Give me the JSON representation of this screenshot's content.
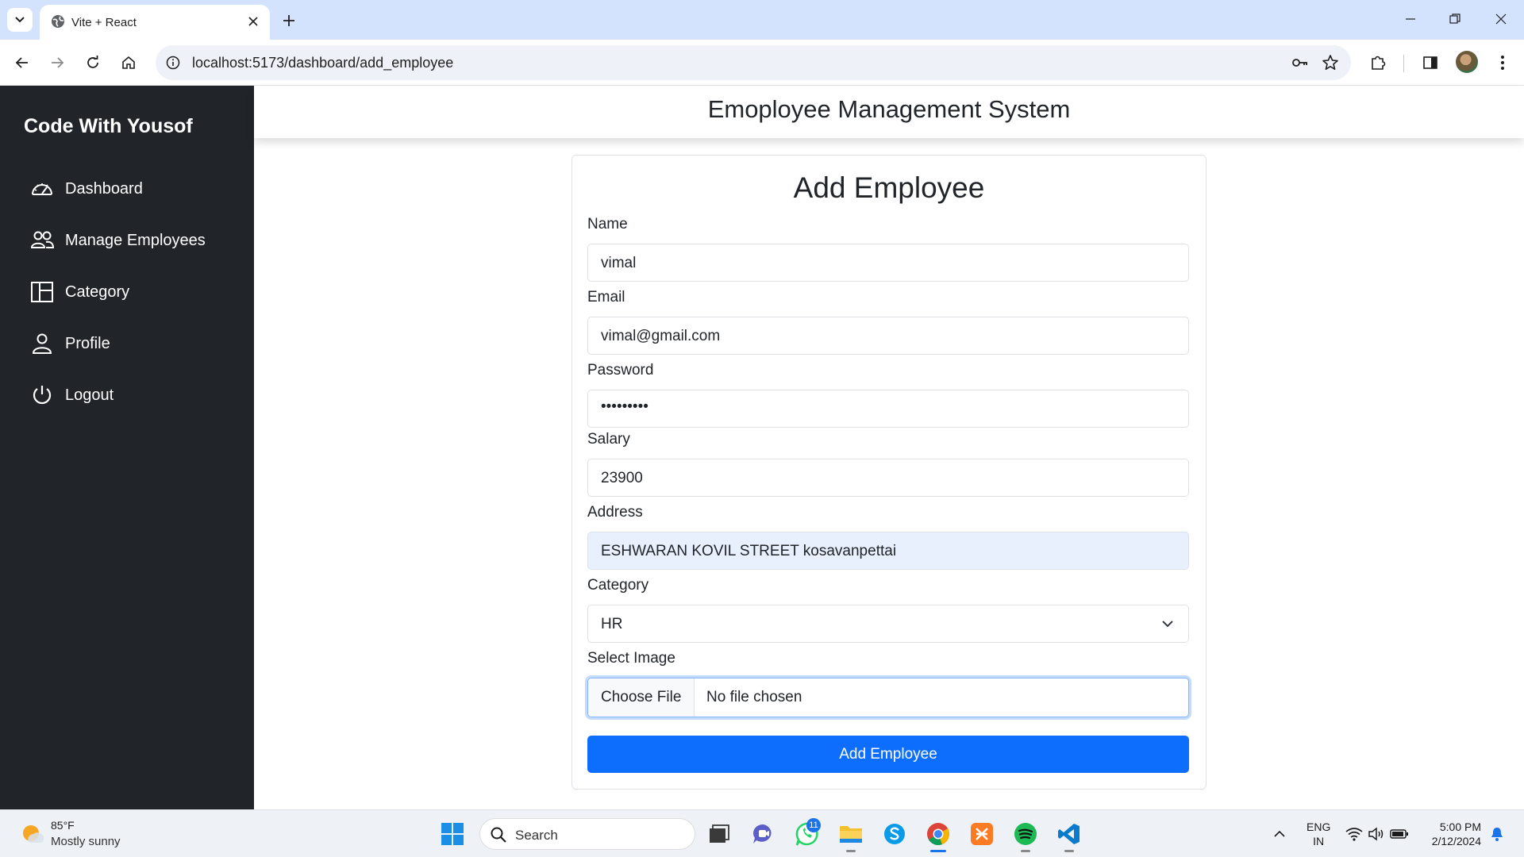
{
  "browser": {
    "tab_title": "Vite + React",
    "url": "localhost:5173/dashboard/add_employee"
  },
  "sidebar": {
    "brand": "Code With Yousof",
    "items": [
      {
        "label": "Dashboard",
        "icon": "speedometer-icon"
      },
      {
        "label": "Manage Employees",
        "icon": "people-icon"
      },
      {
        "label": "Category",
        "icon": "columns-icon"
      },
      {
        "label": "Profile",
        "icon": "person-icon"
      },
      {
        "label": "Logout",
        "icon": "power-icon"
      }
    ]
  },
  "header": {
    "title": "Emoployee Management System"
  },
  "form": {
    "title": "Add Employee",
    "name_label": "Name",
    "name_value": "vimal",
    "email_label": "Email",
    "email_value": "vimal@gmail.com",
    "password_label": "Password",
    "password_value": "•••••••••",
    "salary_label": "Salary",
    "salary_value": "23900",
    "address_label": "Address",
    "address_value": "ESHWARAN KOVIL STREET kosavanpettai",
    "category_label": "Category",
    "category_value": "HR",
    "image_label": "Select Image",
    "choose_file_label": "Choose File",
    "file_status": "No file chosen",
    "submit_label": "Add Employee"
  },
  "taskbar": {
    "weather_temp": "85°F",
    "weather_desc": "Mostly sunny",
    "search_label": "Search",
    "whatsapp_badge": "11",
    "lang_line1": "ENG",
    "lang_line2": "IN",
    "time": "5:00 PM",
    "date": "2/12/2024"
  },
  "colors": {
    "sidebar_bg": "#212529",
    "primary": "#0d6efd",
    "chrome_tabbar": "#d3e3fd"
  }
}
